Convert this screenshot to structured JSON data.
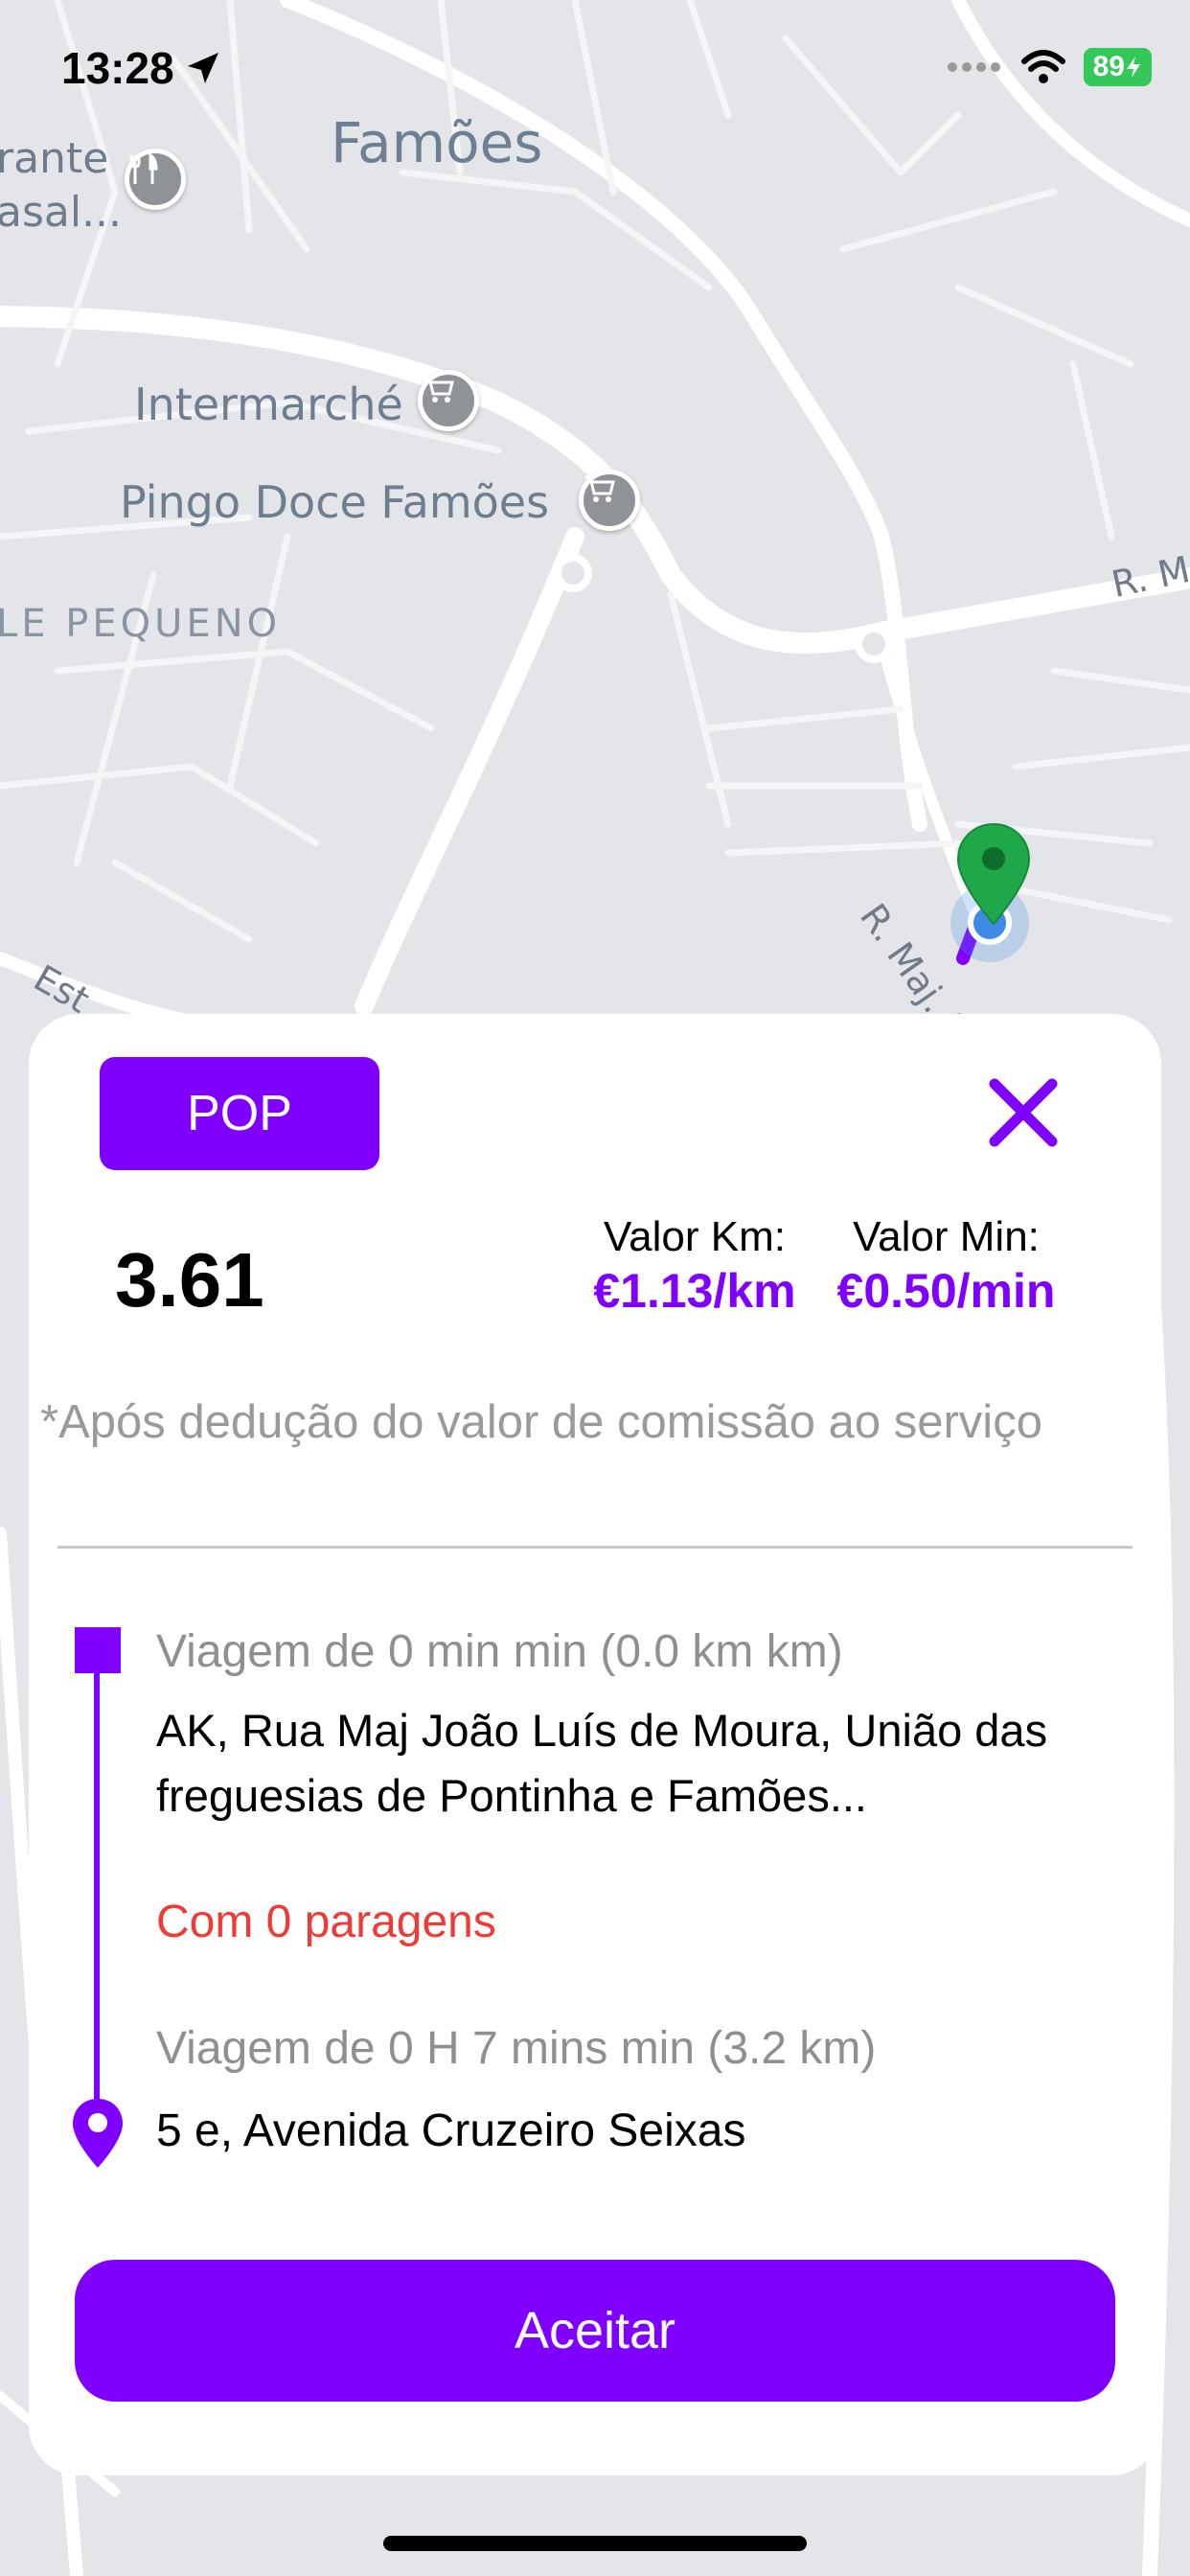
{
  "status_bar": {
    "time": "13:28",
    "battery": "89"
  },
  "map": {
    "labels": {
      "famoes": "Famões",
      "rante_line1": "rante",
      "rante_line2": "asal...",
      "intermarche": "Intermarché",
      "pingo_doce": "Pingo Doce Famões",
      "pequeno": "LE PEQUENO",
      "street_rm": "R. M",
      "street_rmaj": "R. Maj. Jo",
      "street_est": "Est"
    }
  },
  "ride_card": {
    "category": "POP",
    "fare": "3.61",
    "rate_km_label": "Valor Km:",
    "rate_km_value": "€1.13/km",
    "rate_min_label": "Valor Min:",
    "rate_min_value": "€0.50/min",
    "disclaimer": "*Após dedução do valor de comissão ao serviço",
    "pickup_trip": "Viagem de 0 min min (0.0 km km)",
    "pickup_address": "AK, Rua Maj João Luís de Moura, União das freguesias de Pontinha e Famões...",
    "stops": "Com 0 paragens",
    "dropoff_trip": "Viagem de 0 H 7 mins min (3.2 km)",
    "dropoff_address": "5 e, Avenida Cruzeiro Seixas",
    "accept_label": "Aceitar"
  },
  "colors": {
    "accent": "#8000ff",
    "stops_red": "#ef3b36",
    "map_bg": "#e3e5e8",
    "pin_green": "#1ea84a"
  }
}
